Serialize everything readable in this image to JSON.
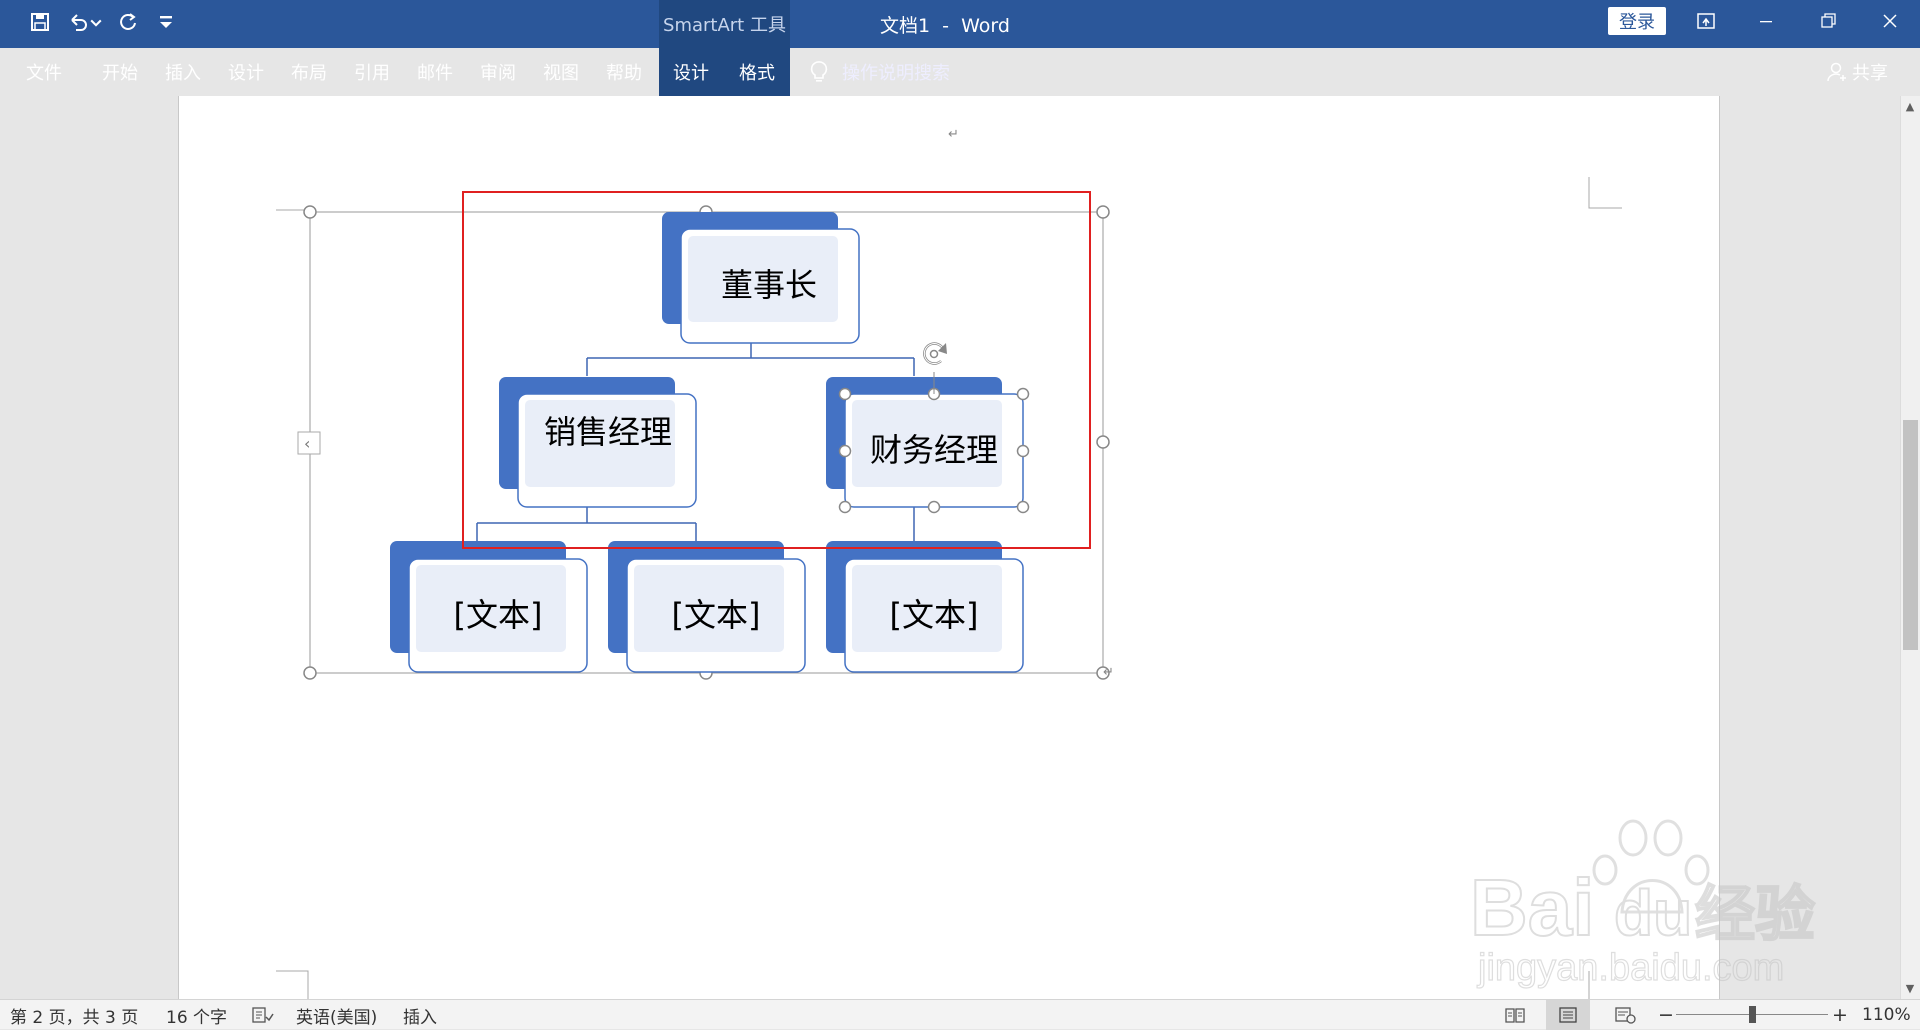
{
  "titlebar": {
    "quick_access": [
      "save-icon",
      "undo-icon",
      "undo-dropdown-icon",
      "redo-icon",
      "customize-qat-icon"
    ],
    "context_tools_label": "SmartArt 工具",
    "doc_title": "文档1  -  Word",
    "login_label": "登录",
    "window_controls": [
      "ribbon-display-icon",
      "minimize-icon",
      "restore-icon",
      "close-icon"
    ]
  },
  "ribbon": {
    "tabs": [
      {
        "label": "文件"
      },
      {
        "label": "开始"
      },
      {
        "label": "插入"
      },
      {
        "label": "设计"
      },
      {
        "label": "布局"
      },
      {
        "label": "引用"
      },
      {
        "label": "邮件"
      },
      {
        "label": "审阅"
      },
      {
        "label": "视图"
      },
      {
        "label": "帮助"
      },
      {
        "label": "设计"
      },
      {
        "label": "格式"
      }
    ],
    "tell_me": "操作说明搜索",
    "share": "共享"
  },
  "document": {
    "paragraph_mark": "↵",
    "smartart": {
      "top_node": "董事长",
      "level2": [
        "销售经理",
        "财务经理"
      ],
      "level3": [
        "[文本]",
        "[文本]",
        "[文本]"
      ],
      "collapse_arrow": "‹",
      "colors": {
        "shadow": "#4472c4",
        "node_fill": "#e9eef8",
        "node_border": "#4472c4",
        "connector": "#3f66b3",
        "highlight": "#e02020"
      }
    }
  },
  "watermark": {
    "brand": "Bai",
    "brand_tail": "du",
    "brand_cn": "经验",
    "url": "jingyan.baidu.com"
  },
  "status": {
    "page": "第 2 页，共 3 页",
    "words": "16 个字",
    "language": "英语(美国)",
    "mode": "插入",
    "zoom_minus": "−",
    "zoom_plus": "+",
    "zoom": "110%"
  }
}
